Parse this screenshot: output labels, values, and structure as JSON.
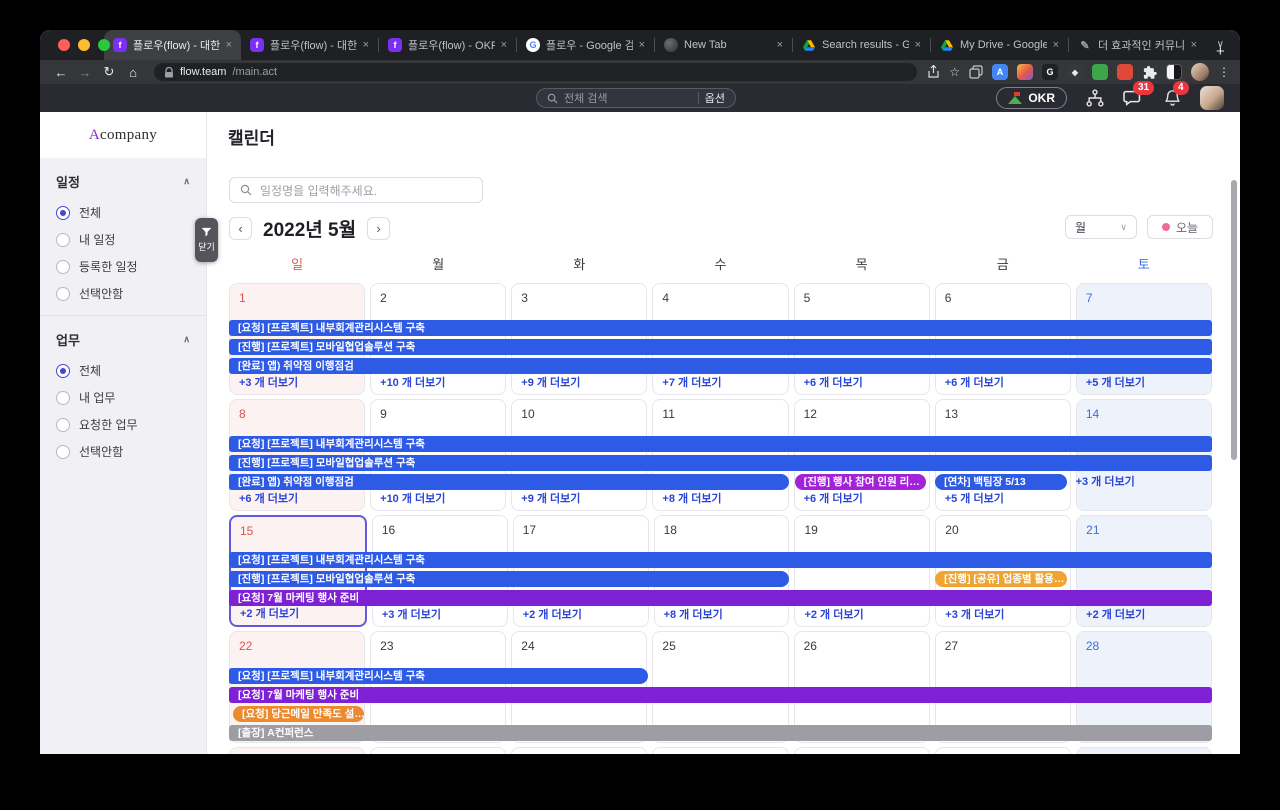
{
  "browser": {
    "tabs": [
      {
        "title": "플로우(flow) - 대한민국",
        "favicon": "flow",
        "active": true
      },
      {
        "title": "플로우(flow) - 대한민국",
        "favicon": "flow",
        "active": false
      },
      {
        "title": "플로우(flow) - OKR",
        "favicon": "flow",
        "active": false
      },
      {
        "title": "플로우 - Google 검색",
        "favicon": "google",
        "active": false
      },
      {
        "title": "New Tab",
        "favicon": "dark",
        "active": false
      },
      {
        "title": "Search results - Goo",
        "favicon": "drive",
        "active": false
      },
      {
        "title": "My Drive - Google D",
        "favicon": "drive",
        "active": false
      },
      {
        "title": "더 효과적인 커뮤니케이",
        "favicon": "doc",
        "active": false
      }
    ],
    "url_host": "flow.team",
    "url_path": "/main.act"
  },
  "icons": {
    "back": "←",
    "forward": "→",
    "reload": "↻",
    "home": "⌂",
    "star": "☆",
    "plus": "+",
    "menu": "⋮",
    "chevron_down": "∨",
    "chevron_up": "∧",
    "prev": "‹",
    "next": "›",
    "close": "×",
    "google_g": "G",
    "translate_a": "A",
    "doc_pencil": "✎",
    "flow_f": "f",
    "compass": "◆"
  },
  "app_bar": {
    "search_placeholder": "전체 검색",
    "search_option": "옵션",
    "okr_label": "OKR",
    "chat_badge": "31",
    "bell_badge": "4"
  },
  "sidebar": {
    "logo_a": "A",
    "logo_rest": "company",
    "close_button": "닫기",
    "sections": [
      {
        "title": "일정",
        "options": [
          {
            "label": "전체",
            "selected": true
          },
          {
            "label": "내 일정",
            "selected": false
          },
          {
            "label": "등록한 일정",
            "selected": false
          },
          {
            "label": "선택안함",
            "selected": false
          }
        ]
      },
      {
        "title": "업무",
        "options": [
          {
            "label": "전체",
            "selected": true
          },
          {
            "label": "내 업무",
            "selected": false
          },
          {
            "label": "요청한 업무",
            "selected": false
          },
          {
            "label": "선택안함",
            "selected": false
          }
        ]
      }
    ]
  },
  "main": {
    "page_title": "캘린더",
    "search_placeholder": "일정명을 입력해주세요.",
    "month_label": "2022년 5월",
    "view_select": "월",
    "today_label": "오늘"
  },
  "calendar": {
    "day_headers": [
      "일",
      "월",
      "화",
      "수",
      "목",
      "금",
      "토"
    ],
    "colors": {
      "blue": "#2E5BE6",
      "violet": "#7E20D4",
      "magenta": "#A321D8",
      "amber": "#F0A432",
      "orange": "#EC8A2F",
      "gray": "#9D9DA3"
    },
    "weeks": [
      {
        "dates": [
          "1",
          "2",
          "3",
          "4",
          "5",
          "6",
          "7"
        ],
        "events": [
          {
            "label": "[요청] [프로젝트] 내부회계관리시스템 구축",
            "color": "blue",
            "start": 0,
            "span": 7,
            "row": 0,
            "shape": "bar"
          },
          {
            "label": "[진행] [프로젝트] 모바일협업솔루션 구축",
            "color": "blue",
            "start": 0,
            "span": 7,
            "row": 1,
            "shape": "bar"
          },
          {
            "label": "[완료] 앱) 취약점 이행점검",
            "color": "blue",
            "start": 0,
            "span": 7,
            "row": 2,
            "shape": "bar"
          }
        ],
        "more": [
          "+3 개 더보기",
          "+10 개 더보기",
          "+9 개 더보기",
          "+7 개 더보기",
          "+6 개 더보기",
          "+6 개 더보기",
          "+5 개 더보기"
        ]
      },
      {
        "dates": [
          "8",
          "9",
          "10",
          "11",
          "12",
          "13",
          "14"
        ],
        "events": [
          {
            "label": "[요청] [프로젝트] 내부회계관리시스템 구축",
            "color": "blue",
            "start": 0,
            "span": 7,
            "row": 0,
            "shape": "bar"
          },
          {
            "label": "[진행] [프로젝트] 모바일협업솔루션 구축",
            "color": "blue",
            "start": 0,
            "span": 7,
            "row": 1,
            "shape": "bar"
          },
          {
            "label": "[완료] 앱) 취약점 이행점검",
            "color": "blue",
            "start": 0,
            "span": 4,
            "row": 2,
            "shape": "pill-right"
          },
          {
            "label": "[진행] 행사 참여 인원 리…",
            "color": "magenta",
            "start": 4,
            "span": 1,
            "row": 2,
            "shape": "pill"
          },
          {
            "label": "[연차] 백팀장 5/13",
            "color": "blue",
            "start": 5,
            "span": 1,
            "row": 2,
            "shape": "pill"
          },
          {
            "label": "+3 개 더보기",
            "color": "blue",
            "start": 6,
            "span": 1,
            "row": 2,
            "shape": "more-inline"
          }
        ],
        "more": [
          "+6 개 더보기",
          "+10 개 더보기",
          "+9 개 더보기",
          "+8 개 더보기",
          "+6 개 더보기",
          "+5 개 더보기",
          ""
        ]
      },
      {
        "dates": [
          "15",
          "16",
          "17",
          "18",
          "19",
          "20",
          "21"
        ],
        "selected_day": 0,
        "events": [
          {
            "label": "[요청] [프로젝트] 내부회계관리시스템 구축",
            "color": "blue",
            "start": 0,
            "span": 7,
            "row": 0,
            "shape": "bar"
          },
          {
            "label": "[진행] [프로젝트] 모바일협업솔루션 구축",
            "color": "blue",
            "start": 0,
            "span": 4,
            "row": 1,
            "shape": "pill-right"
          },
          {
            "label": "[진행] [공유] 업종별 활용…",
            "color": "amber",
            "start": 5,
            "span": 1,
            "row": 1,
            "shape": "pill"
          },
          {
            "label": "[요청] 7월 마케팅 행사 준비",
            "color": "violet",
            "start": 0,
            "span": 7,
            "row": 2,
            "shape": "bar"
          }
        ],
        "more": [
          "+2 개 더보기",
          "+3 개 더보기",
          "+2 개 더보기",
          "+8 개 더보기",
          "+2 개 더보기",
          "+3 개 더보기",
          "+2 개 더보기"
        ]
      },
      {
        "dates": [
          "22",
          "23",
          "24",
          "25",
          "26",
          "27",
          "28"
        ],
        "events": [
          {
            "label": "[요청] [프로젝트] 내부회계관리시스템 구축",
            "color": "blue",
            "start": 0,
            "span": 3,
            "row": 0,
            "shape": "pill-right"
          },
          {
            "label": "[요청] 7월 마케팅 행사 준비",
            "color": "violet",
            "start": 0,
            "span": 7,
            "row": 1,
            "shape": "bar"
          },
          {
            "label": "[요청] 당근메일 만족도 설…",
            "color": "orange",
            "start": 0,
            "span": 1,
            "row": 2,
            "shape": "pill"
          },
          {
            "label": "[출장] A컨퍼런스",
            "color": "gray",
            "start": 0,
            "span": 7,
            "row": 3,
            "shape": "bar"
          }
        ],
        "more": [
          "",
          "",
          "",
          "",
          "",
          "",
          ""
        ]
      }
    ],
    "partial_week": true
  }
}
